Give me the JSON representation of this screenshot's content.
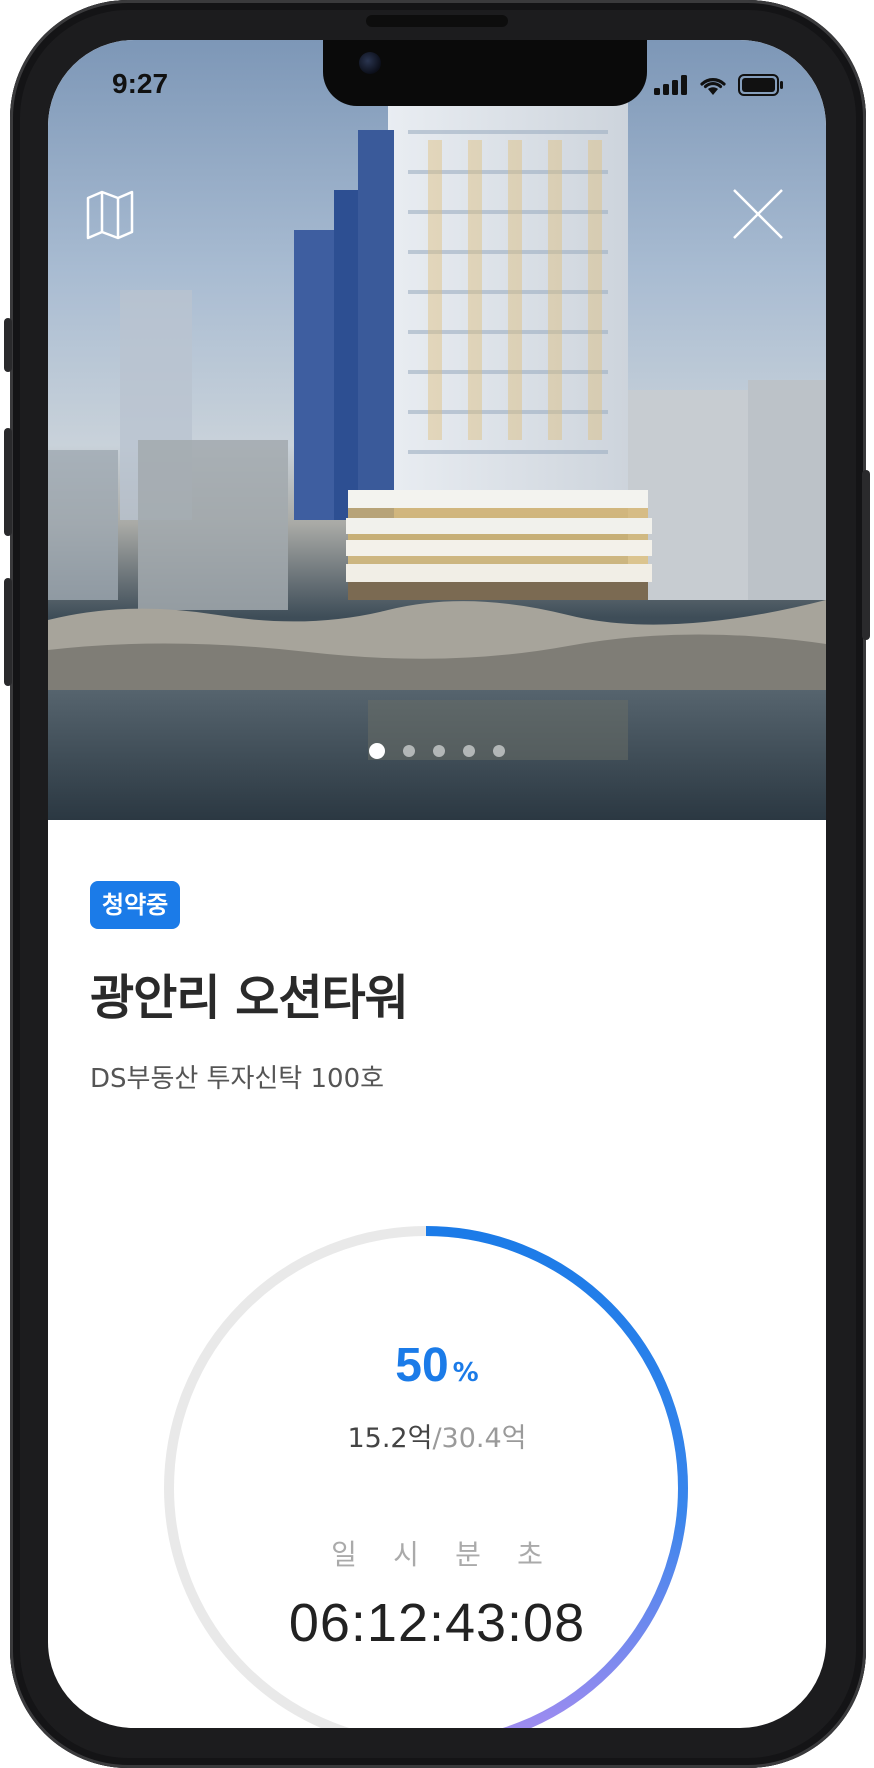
{
  "status_bar": {
    "time": "9:27"
  },
  "hero": {
    "map_icon": "map-icon",
    "close_icon": "close-icon",
    "page_count": 5,
    "active_page": 1
  },
  "project": {
    "badge": "청약중",
    "title": "광안리 오션타워",
    "subtitle": "DS부동산 투자신탁 100호"
  },
  "progress": {
    "percent_value": 50,
    "percent": "50",
    "unit": "%",
    "raised": "15.2억",
    "separator": "/",
    "goal": "30.4억"
  },
  "countdown": {
    "labels": [
      "일",
      "시",
      "분",
      "초"
    ],
    "value": "06:12:43:08"
  },
  "colors": {
    "accent": "#1b7be8",
    "ring_gradient_end": "#a58cf0",
    "ring_track": "#e9e9e9"
  }
}
